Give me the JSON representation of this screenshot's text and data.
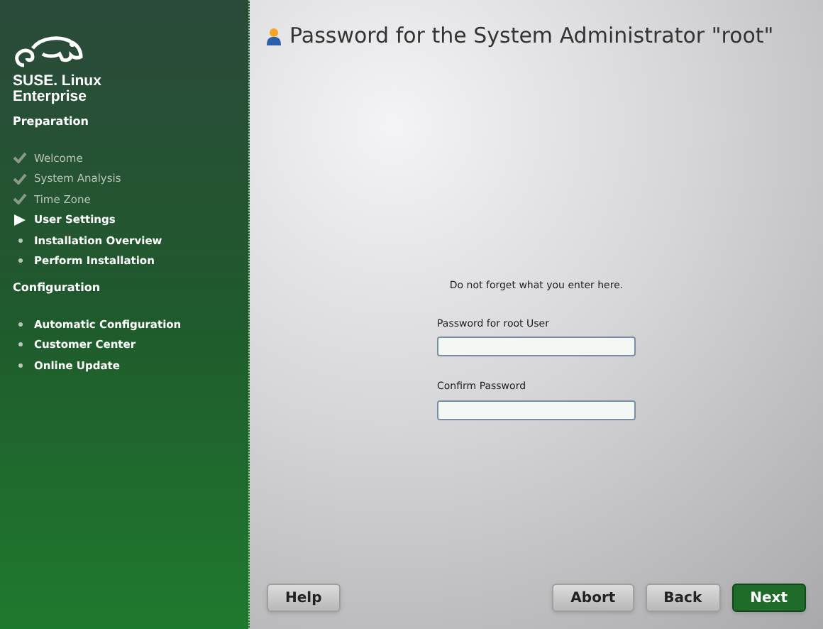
{
  "brand": {
    "name": "SUSE. Linux Enterprise"
  },
  "sections": [
    {
      "title": "Preparation",
      "steps": [
        {
          "label": "Welcome",
          "kind": "done"
        },
        {
          "label": "System Analysis",
          "kind": "done"
        },
        {
          "label": "Time Zone",
          "kind": "done"
        },
        {
          "label": "User Settings",
          "kind": "current"
        },
        {
          "label": "Installation Overview",
          "kind": "pending"
        },
        {
          "label": "Perform Installation",
          "kind": "pending"
        }
      ]
    },
    {
      "title": "Configuration",
      "steps": [
        {
          "label": "Automatic Configuration",
          "kind": "pending"
        },
        {
          "label": "Customer Center",
          "kind": "pending"
        },
        {
          "label": "Online Update",
          "kind": "pending"
        }
      ]
    }
  ],
  "title": "Password for the System Administrator \"root\"",
  "hint": "Do not forget what you enter here.",
  "fields": [
    {
      "label": "Password for root User"
    },
    {
      "label": "Confirm Password"
    }
  ],
  "buttons": {
    "help": "Help",
    "abort": "Abort",
    "back": "Back",
    "next": "Next"
  }
}
